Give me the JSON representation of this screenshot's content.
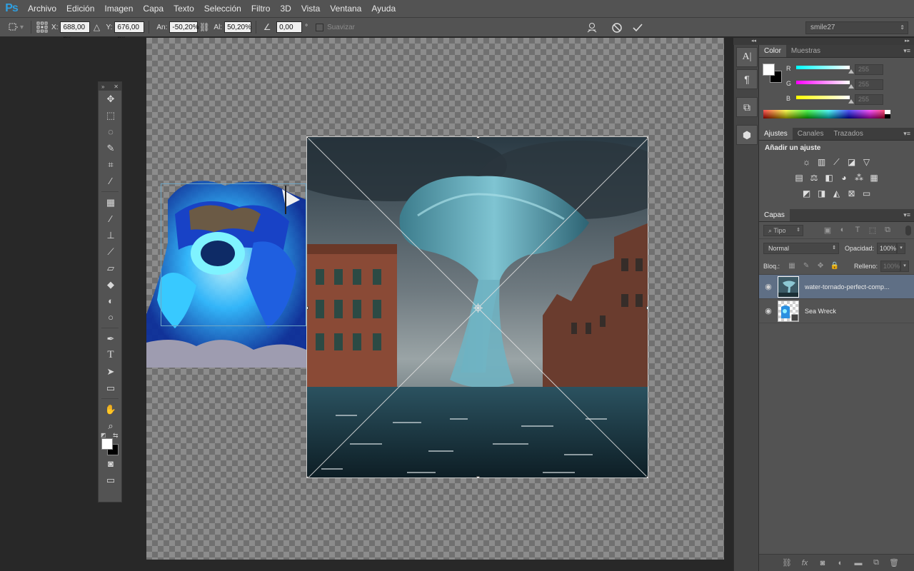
{
  "app": {
    "logo": "Ps",
    "menu": [
      "Archivo",
      "Edición",
      "Imagen",
      "Capa",
      "Texto",
      "Selección",
      "Filtro",
      "3D",
      "Vista",
      "Ventana",
      "Ayuda"
    ]
  },
  "options_bar": {
    "x_label": "X:",
    "x_value": "688,00 px",
    "y_label": "Y:",
    "y_value": "676,00 px",
    "width_label": "An:",
    "width_value": "-50,20%",
    "height_label": "Al:",
    "height_value": "50,20%",
    "angle_value": "0,00",
    "angle_unit": "°",
    "smooth_label": "Suavizar",
    "workspace": "smile27"
  },
  "panels": {
    "color": {
      "tabs": [
        "Color",
        "Muestras"
      ],
      "r_label": "R",
      "g_label": "G",
      "b_label": "B",
      "r_value": "255",
      "g_value": "255",
      "b_value": "255"
    },
    "adjustments": {
      "tabs": [
        "Ajustes",
        "Canales",
        "Trazados"
      ],
      "title": "Añadir un ajuste"
    },
    "layers": {
      "tab": "Capas",
      "kind_filter": "Tipo",
      "blend_mode": "Normal",
      "opacity_label": "Opacidad:",
      "opacity_value": "100%",
      "lock_label": "Bloq.:",
      "fill_label": "Relleno:",
      "fill_value": "100%",
      "items": [
        {
          "name": "water-tornado-perfect-comp...",
          "selected": true
        },
        {
          "name": "Sea Wreck",
          "selected": false
        }
      ]
    }
  },
  "colors": {
    "ui_background": "#535353",
    "canvas_dark": "#282828",
    "selection_blue": "#5f6f85",
    "brand_blue": "#2f9fe0"
  }
}
